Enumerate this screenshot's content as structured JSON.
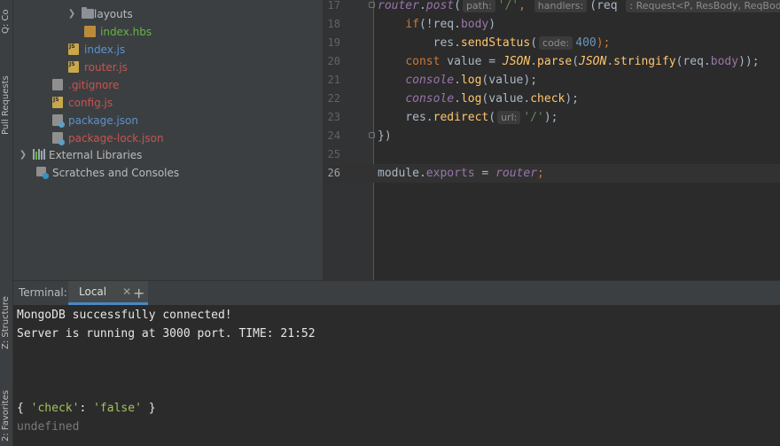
{
  "side_tabs": {
    "top": "Q: Co",
    "pull_requests": "Pull Requests",
    "structure": "Z: Structure",
    "favorites": "2: Favorites"
  },
  "project_tree": [
    {
      "label": "layouts",
      "icon": "folder-icon",
      "color": "plain"
    },
    {
      "label": "index.hbs",
      "icon": "hbs-file-icon",
      "color": "green"
    },
    {
      "label": "index.js",
      "icon": "js-file-icon",
      "color": "blue"
    },
    {
      "label": "router.js",
      "icon": "js-file-icon",
      "color": "red"
    },
    {
      "label": ".gitignore",
      "icon": "gitignore-file-icon",
      "color": "red"
    },
    {
      "label": "config.js",
      "icon": "js-file-icon",
      "color": "red"
    },
    {
      "label": "package.json",
      "icon": "json-file-icon",
      "color": "blue"
    },
    {
      "label": "package-lock.json",
      "icon": "json-file-icon",
      "color": "red"
    },
    {
      "label": "External Libraries",
      "icon": "library-icon",
      "color": "plain"
    },
    {
      "label": "Scratches and Consoles",
      "icon": "scratches-icon",
      "color": "plain"
    }
  ],
  "editor": {
    "lines": [
      {
        "num": "17",
        "parts": [
          {
            "t": "router",
            "c": "k-glob"
          },
          {
            "t": ".",
            "c": "k-var"
          },
          {
            "t": "post",
            "c": "k-it"
          },
          {
            "t": "(",
            "c": "k-var"
          },
          {
            "t": "path:",
            "c": "hint"
          },
          {
            "t": "'/'",
            "c": "k-str"
          },
          {
            "t": ", ",
            "c": "k-kw"
          },
          {
            "t": "handlers:",
            "c": "hint"
          },
          {
            "t": "(req ",
            "c": "k-var"
          },
          {
            "t": ": Request<P, ResBody, ReqBody,",
            "c": "hint"
          }
        ]
      },
      {
        "num": "18",
        "parts": [
          {
            "t": "    ",
            "c": "k-var"
          },
          {
            "t": "if",
            "c": "k-kw"
          },
          {
            "t": "(!req.",
            "c": "k-var"
          },
          {
            "t": "body",
            "c": "k-prop"
          },
          {
            "t": ")",
            "c": "k-var"
          }
        ]
      },
      {
        "num": "19",
        "parts": [
          {
            "t": "        res.",
            "c": "k-var"
          },
          {
            "t": "sendStatus",
            "c": "k-fn"
          },
          {
            "t": "(",
            "c": "k-var"
          },
          {
            "t": "code:",
            "c": "hint"
          },
          {
            "t": "400",
            "c": "k-num"
          },
          {
            "t": ");",
            "c": "k-kw"
          }
        ]
      },
      {
        "num": "20",
        "parts": [
          {
            "t": "    ",
            "c": "k-var"
          },
          {
            "t": "const",
            "c": "k-kw"
          },
          {
            "t": " value = ",
            "c": "k-var"
          },
          {
            "t": "JSON",
            "c": "k-cls"
          },
          {
            "t": ".",
            "c": "k-var"
          },
          {
            "t": "parse",
            "c": "k-fn"
          },
          {
            "t": "(",
            "c": "k-var"
          },
          {
            "t": "JSON",
            "c": "k-cls"
          },
          {
            "t": ".",
            "c": "k-var"
          },
          {
            "t": "stringify",
            "c": "k-fn"
          },
          {
            "t": "(req.",
            "c": "k-var"
          },
          {
            "t": "body",
            "c": "k-prop"
          },
          {
            "t": "));",
            "c": "k-var"
          }
        ]
      },
      {
        "num": "21",
        "parts": [
          {
            "t": "    ",
            "c": "k-var"
          },
          {
            "t": "console",
            "c": "k-glob"
          },
          {
            "t": ".",
            "c": "k-var"
          },
          {
            "t": "log",
            "c": "k-fn"
          },
          {
            "t": "(value);",
            "c": "k-var"
          }
        ]
      },
      {
        "num": "22",
        "parts": [
          {
            "t": "    ",
            "c": "k-var"
          },
          {
            "t": "console",
            "c": "k-glob"
          },
          {
            "t": ".",
            "c": "k-var"
          },
          {
            "t": "log",
            "c": "k-fn"
          },
          {
            "t": "(value.",
            "c": "k-var"
          },
          {
            "t": "check",
            "c": "k-fn"
          },
          {
            "t": ");",
            "c": "k-var"
          }
        ]
      },
      {
        "num": "23",
        "parts": [
          {
            "t": "    res.",
            "c": "k-var"
          },
          {
            "t": "redirect",
            "c": "k-fn"
          },
          {
            "t": "(",
            "c": "k-var"
          },
          {
            "t": "url:",
            "c": "hint"
          },
          {
            "t": "'/'",
            "c": "k-str"
          },
          {
            "t": ");",
            "c": "k-var"
          }
        ]
      },
      {
        "num": "24",
        "parts": [
          {
            "t": "})",
            "c": "k-var"
          }
        ]
      },
      {
        "num": "25",
        "parts": []
      },
      {
        "num": "26",
        "parts": [
          {
            "t": "module",
            "c": "k-var"
          },
          {
            "t": ".",
            "c": "k-var"
          },
          {
            "t": "exports",
            "c": "k-prop"
          },
          {
            "t": " = ",
            "c": "k-var"
          },
          {
            "t": "router",
            "c": "k-glob"
          },
          {
            "t": ";",
            "c": "k-kw"
          }
        ]
      }
    ]
  },
  "terminal": {
    "title": "Terminal:",
    "tab_label": "Local",
    "close_glyph": "✕",
    "add_glyph": "+",
    "line1": "MongoDB successfully connected!",
    "line2": "Server is running at 3000 port. TIME: 21:52",
    "obj_open": "{ ",
    "obj_key": "'check'",
    "obj_colon": ": ",
    "obj_val": "'false'",
    "obj_close": " }",
    "line4": "undefined"
  },
  "colors": {
    "accent": "#4a88c7",
    "background": "#2b2b2b",
    "panel": "#3c3f41"
  }
}
